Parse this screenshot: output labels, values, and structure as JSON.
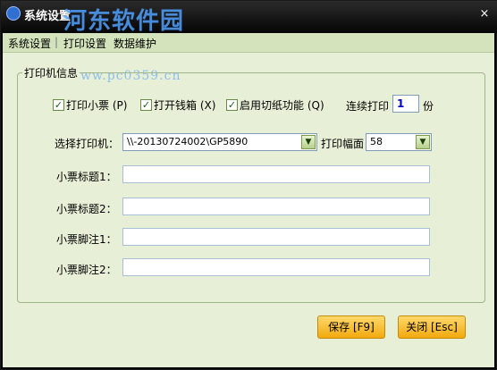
{
  "window": {
    "title": "系统设置",
    "watermark_logo": "河东软件园",
    "watermark_url": "www.pc0359.cn",
    "close_label": "×"
  },
  "tabs": [
    {
      "label": "系统设置"
    },
    {
      "label": "打印设置"
    },
    {
      "label": "数据维护"
    }
  ],
  "printer_group": {
    "title": "打印机信息",
    "checkboxes": [
      {
        "label": "打印小票 (P)",
        "checked": true
      },
      {
        "label": "打开钱箱 (X)",
        "checked": true
      },
      {
        "label": "启用切纸功能 (Q)",
        "checked": true
      }
    ],
    "copies": {
      "label": "连续打印",
      "value": "1",
      "unit": "份"
    },
    "printer_select": {
      "label": "选择打印机：",
      "value": "\\\\-20130724002\\GP5890"
    },
    "width_select": {
      "label": "打印幅面",
      "value": "58"
    },
    "fields": [
      {
        "label": "小票标题1：",
        "value": ""
      },
      {
        "label": "小票标题2：",
        "value": ""
      },
      {
        "label": "小票脚注1：",
        "value": ""
      },
      {
        "label": "小票脚注2：",
        "value": ""
      }
    ]
  },
  "buttons": {
    "save": "保存 [F9]",
    "close": "关闭 [Esc]"
  },
  "colors": {
    "titlebar": "#000000",
    "panel": "#e7efd7",
    "button": "#f5b321"
  }
}
